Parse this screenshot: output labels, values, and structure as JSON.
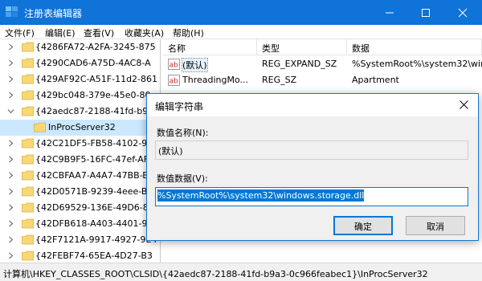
{
  "window": {
    "title": "注册表编辑器"
  },
  "menu": [
    "文件(F)",
    "编辑(E)",
    "查看(V)",
    "收藏夹(A)",
    "帮助(H)"
  ],
  "tree": {
    "items": [
      {
        "label": "{4286FA72-A2FA-3245-875",
        "expander": "collapsed",
        "selected": false,
        "child": false
      },
      {
        "label": "{4290CAD6-A75D-4AC8-A",
        "expander": "collapsed",
        "selected": false,
        "child": false
      },
      {
        "label": "{429AF92C-A51F-11d2-861",
        "expander": "collapsed",
        "selected": false,
        "child": false
      },
      {
        "label": "{429bc048-379e-45e0-80e",
        "expander": "collapsed",
        "selected": false,
        "child": false
      },
      {
        "label": "{42aedc87-2188-41fd-b9a",
        "expander": "expanded",
        "selected": false,
        "child": false
      },
      {
        "label": "InProcServer32",
        "expander": "none",
        "selected": true,
        "child": true
      },
      {
        "label": "{42C21DF5-FB58-4102-90",
        "expander": "collapsed",
        "selected": false,
        "child": false
      },
      {
        "label": "{42C9B9F5-16FC-47ef-AF2",
        "expander": "collapsed",
        "selected": false,
        "child": false
      },
      {
        "label": "{42CBFAA7-A4A7-47BB-B4",
        "expander": "collapsed",
        "selected": false,
        "child": false
      },
      {
        "label": "{42D0571B-9239-4eee-B8",
        "expander": "collapsed",
        "selected": false,
        "child": false
      },
      {
        "label": "{42D69529-136E-49D6-84",
        "expander": "collapsed",
        "selected": false,
        "child": false
      },
      {
        "label": "{42DFB618-A403-4401-90",
        "expander": "collapsed",
        "selected": false,
        "child": false
      },
      {
        "label": "{42F7121A-9917-4927-9E4",
        "expander": "collapsed",
        "selected": false,
        "child": false
      },
      {
        "label": "{42FEBF74-65EA-4D27-B3",
        "expander": "collapsed",
        "selected": false,
        "child": false
      }
    ]
  },
  "values": {
    "columns": [
      "名称",
      "类型",
      "数据"
    ],
    "rows": [
      {
        "name": "(默认)",
        "type": "REG_EXPAND_SZ",
        "data": "%SystemRoot%\\system32\\win",
        "icon": "string-value-icon"
      },
      {
        "name": "ThreadingMo...",
        "type": "REG_SZ",
        "data": "Apartment",
        "icon": "string-value-icon"
      }
    ]
  },
  "dialog": {
    "title": "编辑字符串",
    "name_label": "数值名称(N):",
    "name_value": "(默认)",
    "data_label": "数值数据(V):",
    "data_value": "%SystemRoot%\\system32\\windows.storage.dll",
    "ok_label": "确定",
    "cancel_label": "取消"
  },
  "status": {
    "path": "计算机\\HKEY_CLASSES_ROOT\\CLSID\\{42aedc87-2188-41fd-b9a3-0c966feabec1}\\InProcServer32"
  },
  "colors": {
    "titlebar": "#0f73d8",
    "selection": "#cce8ff",
    "accent": "#0078d7",
    "folder": "#f8d775"
  }
}
